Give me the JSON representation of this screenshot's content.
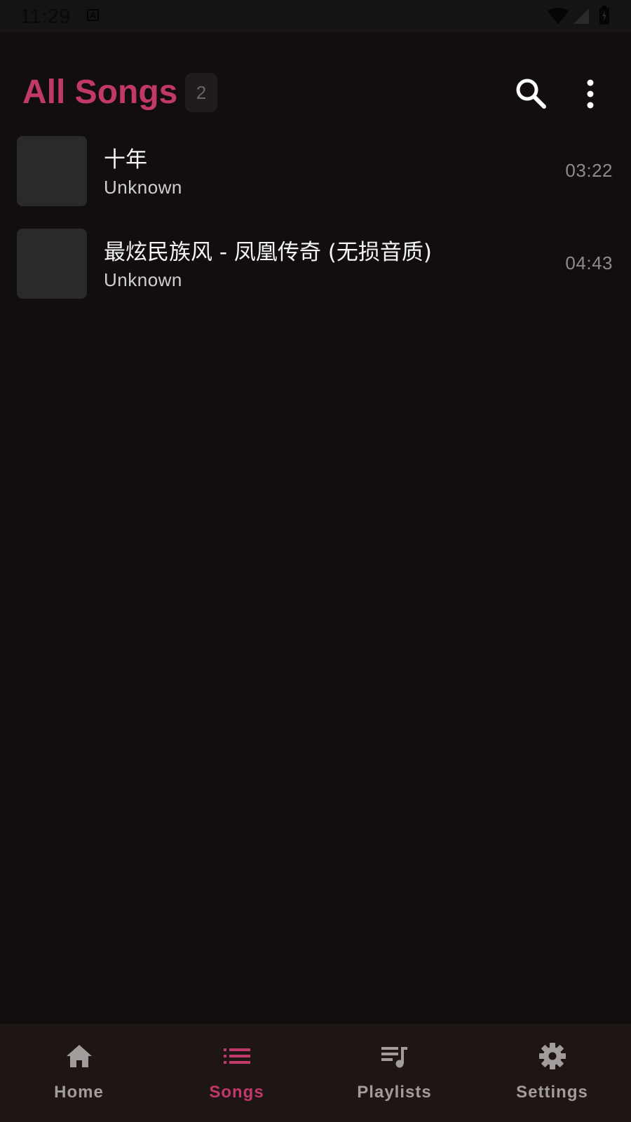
{
  "status_bar": {
    "time": "11:29",
    "notification_icon": "a-icon"
  },
  "header": {
    "title": "All Songs",
    "count": "2",
    "search_icon": "search-icon",
    "more_icon": "more-vert-icon"
  },
  "songs": [
    {
      "title": "十年",
      "artist": "Unknown",
      "duration": "03:22"
    },
    {
      "title": "最炫民族风 - 凤凰传奇 (无损音质)",
      "artist": "Unknown",
      "duration": "04:43"
    }
  ],
  "bottom_nav": {
    "items": [
      {
        "label": "Home",
        "icon": "home-icon",
        "active": false
      },
      {
        "label": "Songs",
        "icon": "list-icon",
        "active": true
      },
      {
        "label": "Playlists",
        "icon": "playlist-icon",
        "active": false
      },
      {
        "label": "Settings",
        "icon": "gear-icon",
        "active": false
      }
    ]
  },
  "colors": {
    "accent": "#c1386a",
    "background": "#120e0e",
    "nav_background": "#1e1515",
    "inactive": "#a29c9c"
  }
}
